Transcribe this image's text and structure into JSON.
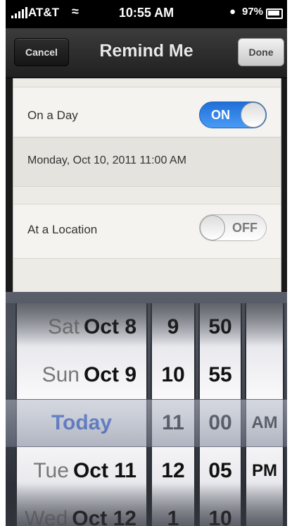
{
  "status_bar": {
    "carrier": "AT&T",
    "time": "10:55 AM",
    "battery": "97%"
  },
  "nav": {
    "title": "Remind Me",
    "cancel_label": "Cancel",
    "done_label": "Done"
  },
  "on_a_day": {
    "label": "On a Day",
    "toggle_label": "ON",
    "enabled": true,
    "date_value": "Monday, Oct 10, 2011 11:00 AM"
  },
  "at_a_location": {
    "label": "At a Location",
    "toggle_label": "OFF",
    "enabled": false
  },
  "picker": {
    "days": [
      {
        "dow": "Sat",
        "date": "Oct 8"
      },
      {
        "dow": "Sun",
        "date": "Oct 9"
      },
      {
        "dow": "",
        "date": "Today"
      },
      {
        "dow": "Tue",
        "date": "Oct 11"
      },
      {
        "dow": "Wed",
        "date": "Oct 12"
      }
    ],
    "hours": [
      "9",
      "10",
      "11",
      "12",
      "1"
    ],
    "minutes": [
      "50",
      "55",
      "00",
      "05",
      "10"
    ],
    "ampm": [
      "",
      "",
      "AM",
      "PM",
      ""
    ]
  },
  "colors": {
    "toggle_on": "#2f7ee6",
    "today_text": "#2556d9"
  }
}
